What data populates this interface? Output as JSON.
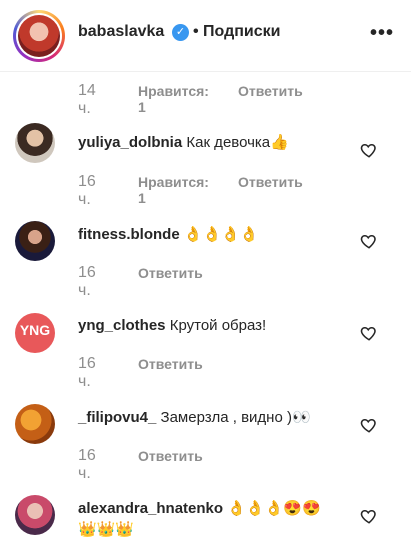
{
  "header": {
    "username": "babaslavka",
    "verified_glyph": "✓",
    "separator": "•",
    "follow_label": "Подписки",
    "more_label": "•••"
  },
  "first_meta": {
    "time": "14 ч.",
    "likes": "Нравится: 1",
    "reply": "Ответить"
  },
  "comments": [
    {
      "user": "yuliya_dolbnia",
      "text": "Как девочка👍",
      "time": "16 ч.",
      "likes": "Нравится: 1",
      "reply": "Ответить"
    },
    {
      "user": "fitness.blonde",
      "text": "👌👌👌👌",
      "time": "16 ч.",
      "likes": "",
      "reply": "Ответить"
    },
    {
      "user": "yng_clothes",
      "text": "Крутой образ!",
      "time": "16 ч.",
      "likes": "",
      "reply": "Ответить",
      "avatar_text": "YNG"
    },
    {
      "user": "_filipovu4_",
      "text": "Замерзла , видно )👀",
      "time": "16 ч.",
      "likes": "",
      "reply": "Ответить"
    },
    {
      "user": "alexandra_hnatenko",
      "text": "👌👌👌😍😍",
      "text2": "👑👑👑"
    }
  ],
  "icons": {
    "heart": "heart-outline-icon",
    "verified": "verified-badge-icon",
    "more": "more-options-icon"
  }
}
